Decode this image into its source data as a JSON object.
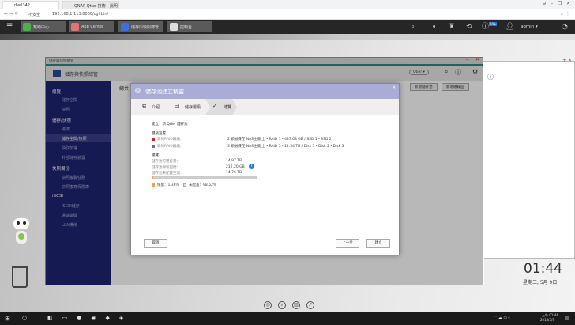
{
  "browser": {
    "tabs": [
      {
        "label": "dw0342"
      },
      {
        "label": "QNAP Qtier 技術 - 說明"
      }
    ],
    "address_prefix": "不安全",
    "url": "192.168.1.113:8080/cgi-bin/"
  },
  "qts": {
    "apps": [
      {
        "label": "幫助中心",
        "color": "#4caf50"
      },
      {
        "label": "App Center",
        "color": "#e57373"
      },
      {
        "label": "儲存與快照總管",
        "color": "#3f6fd8"
      },
      {
        "label": "控制台",
        "color": "#dddddd"
      }
    ],
    "notification_count": "10+",
    "user": "admin ▾"
  },
  "app": {
    "window_title": "儲存與快照總管",
    "title": "儲存與快照總管",
    "qtier_button": "Qtier ▾",
    "new_pool_button": "新增儲存池",
    "new_volume_button": "新增磁碟區",
    "content_tab": "總共",
    "sidebar": [
      {
        "group": "總覽",
        "items": [
          "儲存空間",
          "快照"
        ]
      },
      {
        "group": "儲存/快照",
        "items": [
          "磁碟",
          "儲存空間/快照",
          "快取加速",
          "外部儲存裝置"
        ]
      },
      {
        "group": "快照備份",
        "items": [
          "快照複製任務",
          "快照複寫保險庫"
        ]
      },
      {
        "group": "iSCSI",
        "items": [
          "iSCSI儲存",
          "遠端磁碟",
          "LUN備份"
        ]
      }
    ]
  },
  "wizard": {
    "title": "儲存池建立精靈",
    "steps": [
      "介紹",
      "儲存層級",
      "總覽"
    ],
    "create_line": "建立：新 Qtier 儲存池",
    "tier_heading": "層級設置：",
    "tiers": [
      {
        "label": "新的RAID群組：",
        "detail": "2 顆磁碟在 NAS主機 上・RAID 1・437.63 GB / SSD 1・SSD 2",
        "color": "#c62828"
      },
      {
        "label": "新的RAID群組：",
        "detail": "3 顆磁碟在 NAS主機 上・RAID 5・14.54 TB / Disk 1・Disk 2・Disk 3",
        "color": "#3f7fc9"
      }
    ],
    "summary_heading": "總覽：",
    "summary": [
      {
        "label": "儲存池可用容量：",
        "value": "14.97 TB"
      },
      {
        "label": "儲存池保留空間：",
        "value": "212.20 GB"
      },
      {
        "label": "儲存池未配置空間：",
        "value": "14.76 TB"
      }
    ],
    "reserved_pct": 1.38,
    "legend_reserved": "保留：1.38%",
    "legend_unallocated": "未配置：98.62%",
    "cancel": "取消",
    "back": "上一步",
    "create": "建立"
  },
  "desktop": {
    "time": "01:44",
    "date": "星期三, 5月 9日"
  },
  "taskbar": {
    "time": "上午 01:44",
    "date": "2018/5/9"
  }
}
